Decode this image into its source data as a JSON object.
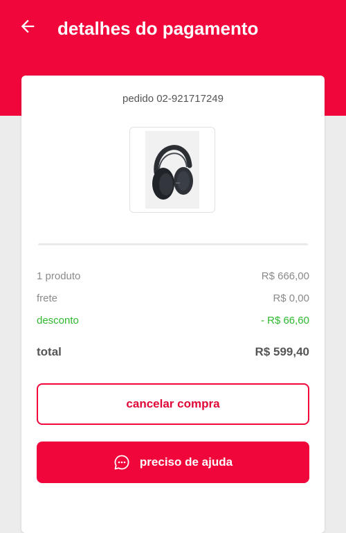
{
  "header": {
    "title": "detalhes do pagamento",
    "back_icon": "arrow-left-icon"
  },
  "order": {
    "id_label": "pedido 02-921717249",
    "product_image": "headphones-product-image"
  },
  "summary": {
    "rows": [
      {
        "label": "1 produto",
        "value": "R$ 666,00"
      },
      {
        "label": "frete",
        "value": "R$ 0,00"
      },
      {
        "label": "desconto",
        "value": "- R$ 66,60"
      }
    ],
    "total": {
      "label": "total",
      "value": "R$ 599,40"
    }
  },
  "actions": {
    "cancel_label": "cancelar compra",
    "help_label": "preciso de ajuda",
    "help_icon": "chat-bubble-icon"
  },
  "colors": {
    "brand": "#f0063a",
    "discount": "#2eb82e",
    "background": "#ececec"
  }
}
